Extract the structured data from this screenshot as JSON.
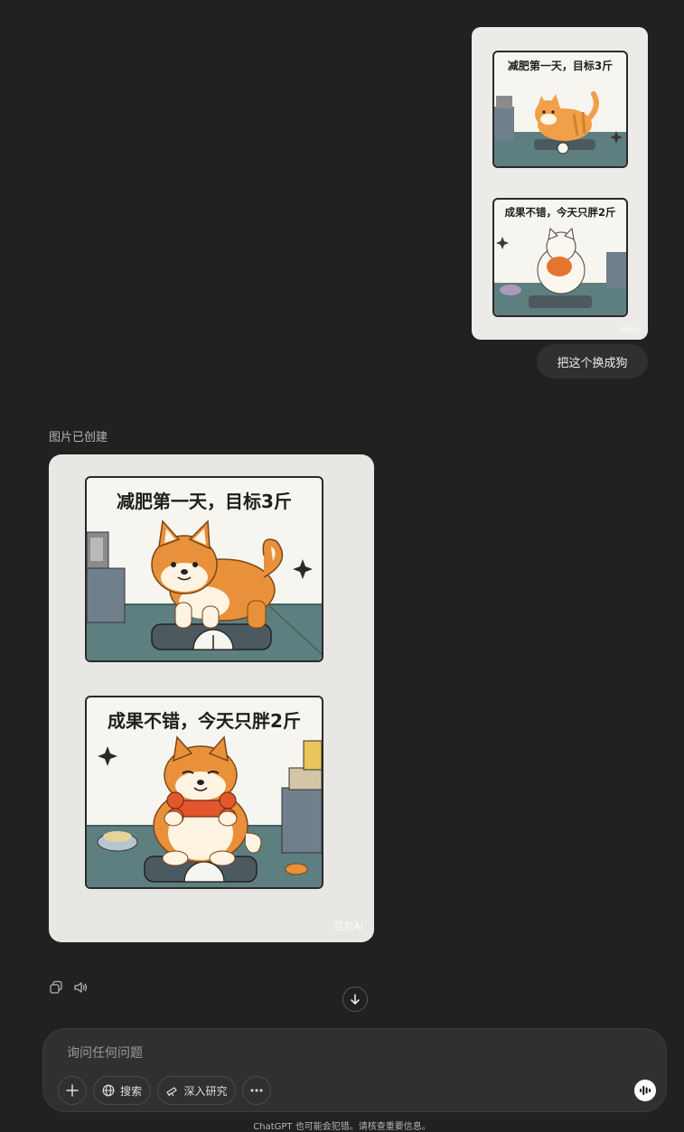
{
  "conversation": {
    "user_message": {
      "image": {
        "panel_top_caption": "减肥第一天，目标3斤",
        "panel_bottom_caption": "成果不错，今天只胖2斤",
        "watermark": "豆包AI"
      },
      "text": "把这个换成狗"
    },
    "assistant_message": {
      "status": "图片已创建",
      "image": {
        "panel_top_caption": "减肥第一天，目标3斤",
        "panel_bottom_caption": "成果不错，今天只胖2斤",
        "watermark": "豆包AI"
      },
      "actions": [
        "copy-icon",
        "speaker-icon"
      ]
    }
  },
  "composer": {
    "placeholder": "询问任何问题",
    "tools": {
      "add_icon": "plus-icon",
      "search_label": "搜索",
      "research_label": "深入研究",
      "more_icon": "ellipsis-icon"
    },
    "voice_icon": "voice-mode-icon"
  },
  "footer": {
    "disclaimer": "ChatGPT 也可能会犯错。请核查重要信息。"
  },
  "colors": {
    "background": "#212121",
    "bubble": "#303030",
    "dog_orange": "#e8913a",
    "cat_orange": "#f0a048",
    "floor_teal": "#5e7f7f"
  }
}
